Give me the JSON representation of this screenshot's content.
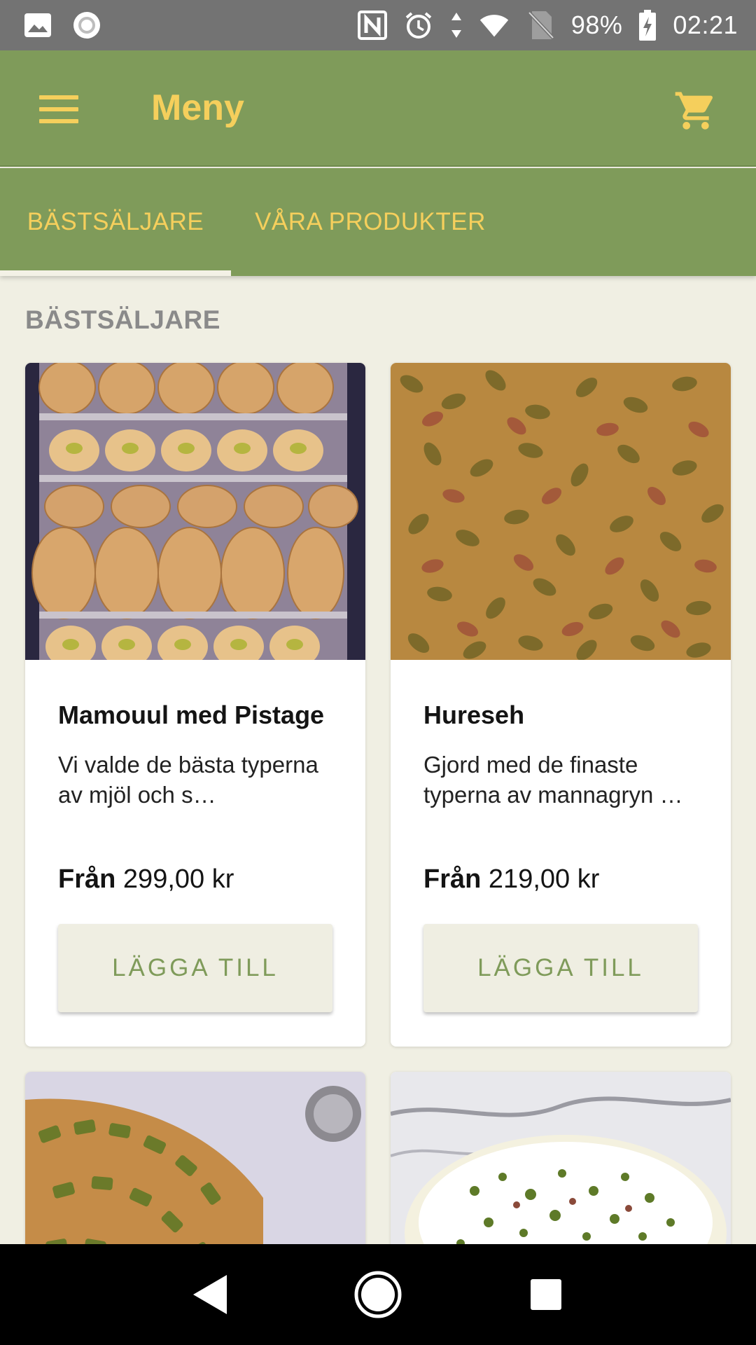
{
  "status_bar": {
    "battery": "98%",
    "time": "02:21",
    "icons": [
      "image-icon",
      "record-icon",
      "nfc-icon",
      "alarm-icon",
      "data-arrows-icon",
      "wifi-icon",
      "no-sim-icon",
      "battery-charging-icon"
    ]
  },
  "app_bar": {
    "title": "Meny",
    "menu_icon": "hamburger-menu-icon",
    "cart_icon": "shopping-cart-icon"
  },
  "tabs": [
    {
      "label": "BÄSTSÄLJARE",
      "selected": true
    },
    {
      "label": "VÅRA PRODUKTER",
      "selected": false
    }
  ],
  "section": {
    "title": "BÄSTSÄLJARE"
  },
  "products": [
    {
      "name": "Mamouul med Pistage",
      "description": "Vi valde de bästa typerna av mjöl och s…",
      "price_prefix": "Från",
      "price": "299,00 kr",
      "button": "LÄGGA TILL"
    },
    {
      "name": "Hureseh",
      "description": "Gjord med de finaste typerna av mannagryn …",
      "price_prefix": "Från",
      "price": "219,00 kr",
      "button": "LÄGGA TILL"
    }
  ],
  "colors": {
    "primary": "#7f9b5a",
    "accent": "#f5cf5c",
    "background": "#f0efe3",
    "status_bar": "#737373"
  },
  "nav_bar": {
    "back": "back-triangle-icon",
    "home": "home-circle-icon",
    "recents": "recents-square-icon"
  }
}
